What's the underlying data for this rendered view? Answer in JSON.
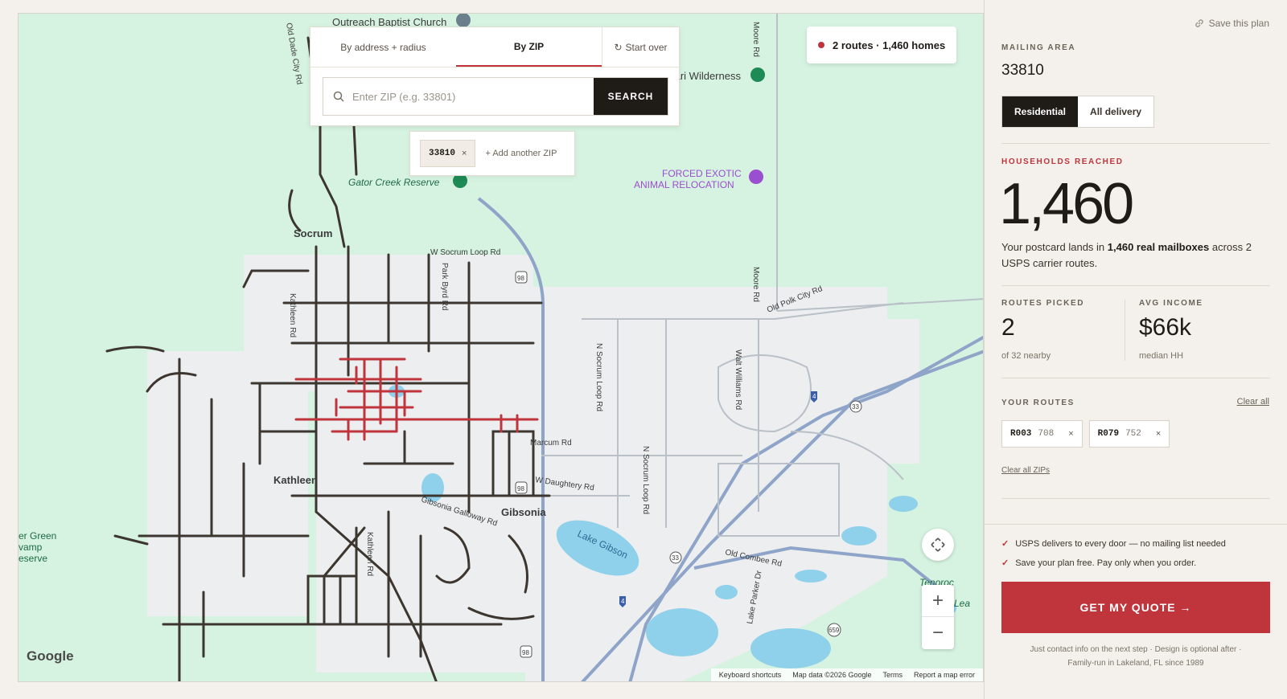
{
  "map": {
    "labels": {
      "church": "Outreach Baptist Church",
      "safari": "fari Wilderness",
      "gator": "Gator Creek Reserve",
      "forced": "FORCED EXOTIC",
      "animal": "ANIMAL RELOCATION",
      "socrum": "Socrum",
      "kathleen": "Kathleen",
      "gibsonia": "Gibsonia",
      "lake_gibson": "Lake Gibson",
      "green_swamp_1": "er Green",
      "green_swamp_2": "vamp",
      "green_swamp_3": "eserve",
      "tenoroc": "Tenoroc",
      "lea": "Lea",
      "w_socrum_loop": "W Socrum Loop Rd",
      "old_polk_city": "Old Polk City Rd",
      "marcum": "Marcum Rd",
      "w_daughtery": "W Daughtery Rd",
      "gibsonia_galloway": "Gibsonia Galloway Rd",
      "old_combee": "Old Combee Rd",
      "moore_rd": "Moore Rd",
      "n_socrum_loop": "N Socrum Loop Rd",
      "walt_williams": "Walt Williams Rd",
      "kathleen_rd": "Kathleen Rd",
      "old_dade": "Old Dade City Rd",
      "parkway_rd": "Park Byrd Rd",
      "lake_parker": "Lake Parker Dr",
      "hwy98": "98",
      "i4": "4",
      "hwy33": "33",
      "hwy659": "659"
    },
    "google": "Google",
    "attribution": [
      "Keyboard shortcuts",
      "Map data ©2026 Google",
      "Terms",
      "Report a map error"
    ]
  },
  "mode_card": {
    "tab_address": "By address + radius",
    "tab_zip": "By ZIP",
    "start_over": "Start over",
    "reset_icon": "↻",
    "search_placeholder": "Enter ZIP (e.g. 33801)",
    "search_button": "SEARCH"
  },
  "zip_chips": {
    "zips": [
      "33810"
    ],
    "remove": "×",
    "add_another": "+ Add another ZIP"
  },
  "route_pill": {
    "text": "2 routes · 1,460 homes",
    "accent": "#c0343c"
  },
  "sidebar": {
    "save_plan": "Save this plan",
    "mailing_area_label": "MAILING AREA",
    "mailing_area": "33810",
    "type_residential": "Residential",
    "type_all": "All delivery",
    "households_label": "HOUSEHOLDS REACHED",
    "households": "1,460",
    "desc_pre": "Your postcard lands in ",
    "desc_bold": "1,460 real mailboxes",
    "desc_post": " across 2 USPS carrier routes.",
    "routes_picked_label": "ROUTES PICKED",
    "routes_picked": "2",
    "routes_picked_sub": "of 32 nearby",
    "avg_income_label": "AVG INCOME",
    "avg_income": "$66k",
    "avg_income_sub": "median HH",
    "your_routes_label": "YOUR ROUTES",
    "clear_all": "Clear all",
    "routes": [
      {
        "id": "R003",
        "count": "708"
      },
      {
        "id": "R079",
        "count": "752"
      }
    ],
    "remove": "×",
    "clear_zips": "Clear all ZIPs",
    "checks": [
      "USPS delivers to every door — no mailing list needed",
      "Save your plan free. Pay only when you order."
    ],
    "tick": "✓",
    "cta": "GET MY QUOTE →",
    "fine_1": "Just contact info on the next step · Design is optional after ·",
    "fine_2": "Family-run in Lakeland, FL since 1989"
  },
  "colors": {
    "accent": "#c0343c",
    "dark": "#1f1b16",
    "map_green": "#d6f2e0",
    "water": "#8fd0ea"
  }
}
